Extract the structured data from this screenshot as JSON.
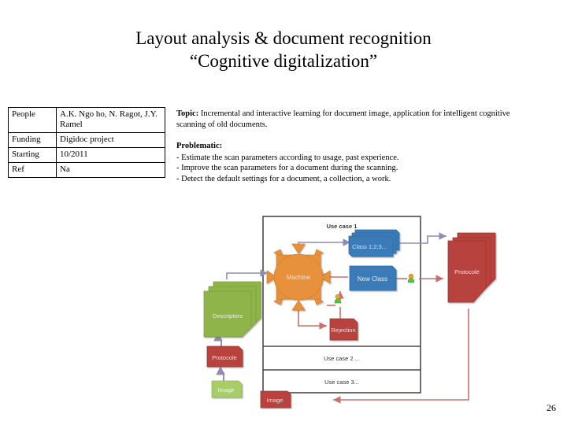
{
  "slide": {
    "title_line1": "Layout analysis & document recognition",
    "title_line2": "“Cognitive digitalization”",
    "page_number": "26"
  },
  "info_table": {
    "rows": [
      {
        "label": "People",
        "value": "A.K. Ngo ho, N. Ragot, J.Y. Ramel"
      },
      {
        "label": "Funding",
        "value": "Digidoc project"
      },
      {
        "label": "Starting",
        "value": "10/2011"
      },
      {
        "label": "Ref",
        "value": "Na"
      }
    ]
  },
  "description": {
    "topic_label": "Topic:",
    "topic_text": " Incremental and interactive learning for document image, application for intelligent cognitive scanning of old documents.",
    "problematic_label": "Problematic:",
    "bullets": [
      "- Estimate the scan parameters according to usage, past experience.",
      "- Improve the scan parameters for a document during the scanning.",
      "- Detect the default settings for a document, a collection, a work."
    ]
  },
  "diagram": {
    "frame_labels": {
      "use_case_1": "Use case 1",
      "use_case_2": "Use case 2 ...",
      "use_case_3": "Use case 3..."
    },
    "nodes": {
      "machine": "Machine",
      "descriptors": "Descriptors",
      "class_list": "Class 1;2;3...",
      "new_class": "New Class",
      "rejection": "Rejection",
      "protocole_right": "Protocole",
      "protocole_left": "Protocole",
      "image_green": "Image",
      "image_red": "Image"
    },
    "colors": {
      "orange": "#E8913C",
      "orange_dark": "#D4812F",
      "green": "#8FB44A",
      "green_light": "#A9CC6B",
      "blue": "#3B7CB8",
      "blue_dark": "#2F6A9F",
      "red": "#B8433E",
      "red_dark": "#9E3733",
      "frame": "#4A4A4A",
      "arrow_purple": "#8D8DB5",
      "arrow_red": "#C8706B"
    }
  }
}
